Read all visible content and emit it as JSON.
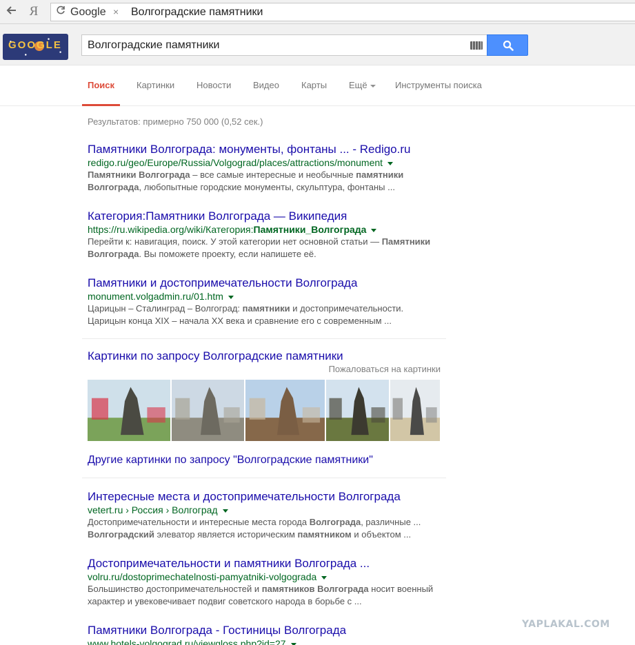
{
  "browser": {
    "back_icon": "arrow-left-icon",
    "yandex_glyph": "Я",
    "site_label": "Google",
    "close_glyph": "×",
    "address_text": "Волгоградские памятники"
  },
  "header": {
    "doodle_text": "GOOGLE",
    "search_value": "Волгоградские памятники"
  },
  "tabs": [
    {
      "label": "Поиск",
      "active": true
    },
    {
      "label": "Картинки"
    },
    {
      "label": "Новости"
    },
    {
      "label": "Видео"
    },
    {
      "label": "Карты"
    },
    {
      "label": "Ещё"
    },
    {
      "label": "Инструменты поиска"
    }
  ],
  "stats": "Результатов: примерно 750 000 (0,52 сек.)",
  "results": [
    {
      "title": "Памятники Волгограда: монументы, фонтаны ... - Redigo.ru",
      "url": "redigo.ru/geo/Europe/Russia/Volgograd/places/attractions/monument",
      "snippet": [
        [
          {
            "b": "Памятники Волгограда"
          },
          {
            "t": " – все самые интересные и необычные "
          },
          {
            "b": "памятники"
          }
        ],
        [
          {
            "b": "Волгограда"
          },
          {
            "t": ", любопытные городские монументы, скульптура, фонтаны ..."
          }
        ]
      ]
    },
    {
      "title": "Категория:Памятники Волгограда — Википедия",
      "url_parts": [
        {
          "t": "https://ru.wikipedia.org/wiki/Категория:"
        },
        {
          "b": "Памятники_Волгограда"
        }
      ],
      "snippet": [
        [
          {
            "t": "Перейти к: навигация, поиск. У этой категории нет основной статьи — "
          },
          {
            "b": "Памятники"
          }
        ],
        [
          {
            "b": "Волгограда"
          },
          {
            "t": ". Вы поможете проекту, если напишете её."
          }
        ]
      ]
    },
    {
      "title": "Памятники и достопримечательности Волгограда",
      "url": "monument.volgadmin.ru/01.htm",
      "snippet": [
        [
          {
            "t": "Царицын – Сталинград – Волгоград: "
          },
          {
            "b": "памятники"
          },
          {
            "t": " и достопримечательности."
          }
        ],
        [
          {
            "t": "Царицын конца XIX – начала XX века и сравнение его с современным ..."
          }
        ]
      ]
    }
  ],
  "images": {
    "title": "Картинки по запросу Волгоградские памятники",
    "report": "Пожаловаться на картинки",
    "more": "Другие картинки по запросу \"Волгоградские памятники\"",
    "thumbs": [
      {
        "sky": "#cfe0ea",
        "ground": "#7ba35a",
        "accent": "#d9364a",
        "statue": "#4a4a42"
      },
      {
        "sky": "#cdd9e4",
        "ground": "#8f8c80",
        "accent": "#a8a496",
        "statue": "#6d6a60"
      },
      {
        "sky": "#b9d1e8",
        "ground": "#86684a",
        "accent": "#c8b89e",
        "statue": "#7a5e44"
      },
      {
        "sky": "#d3e2ee",
        "ground": "#6a7840",
        "accent": "#4c4a3c",
        "statue": "#3c3a30"
      },
      {
        "sky": "#e6ebef",
        "ground": "#d2c6a6",
        "accent": "#8a8a88",
        "statue": "#4a4a48"
      }
    ]
  },
  "results2": [
    {
      "title": "Интересные места и достопримечательности Волгограда",
      "url": "vetert.ru › Россия › Волгоград",
      "snippet": [
        [
          {
            "t": "Достопримечательности и интересные места города "
          },
          {
            "b": "Волгограда"
          },
          {
            "t": ", различные ..."
          }
        ],
        [
          {
            "b": "Волгоградский"
          },
          {
            "t": " элеватор является историческим "
          },
          {
            "b": "памятником"
          },
          {
            "t": " и объектом ..."
          }
        ]
      ]
    },
    {
      "title": "Достопримечательности и памятники Волгограда ...",
      "url": "volru.ru/dostoprimechatelnosti-pamyatniki-volgograda",
      "snippet": [
        [
          {
            "t": "Большинство достопримечательностей и "
          },
          {
            "b": "памятников Волгограда"
          },
          {
            "t": " носит военный"
          }
        ],
        [
          {
            "t": "характер и увековечивает подвиг советского народа в борьбе с ..."
          }
        ]
      ]
    },
    {
      "title": "Памятники Волгограда - Гостиницы Волгограда",
      "url": "www.hotels-volgograd.ru/viewgloss.php?id=27",
      "snippet": []
    }
  ],
  "watermark": "YAPLAKAL.COM"
}
